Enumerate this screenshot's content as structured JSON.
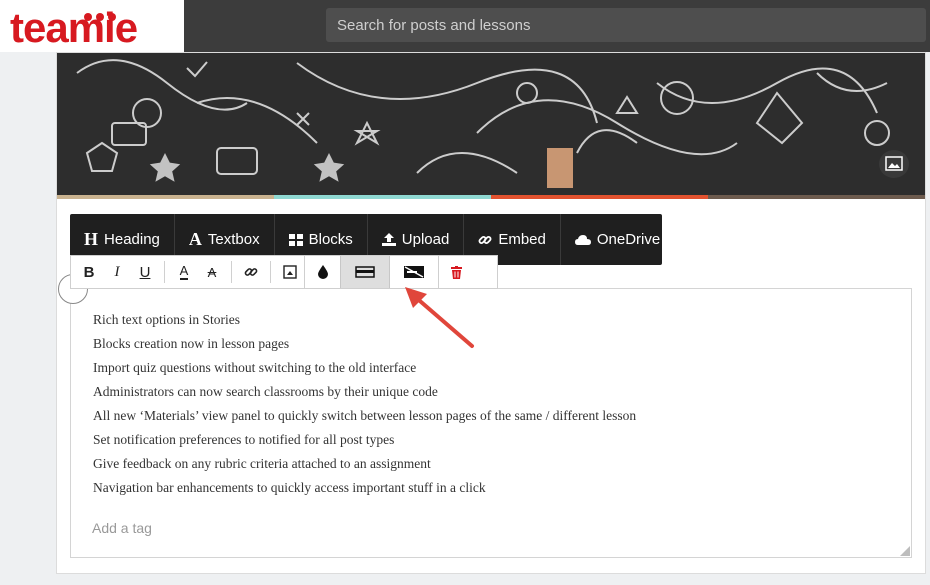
{
  "brand": {
    "logo_text": "teamie"
  },
  "search": {
    "placeholder": "Search for posts and lessons"
  },
  "toolbar": {
    "items": [
      {
        "label": "Heading",
        "icon": "heading-icon",
        "glyph": "H"
      },
      {
        "label": "Textbox",
        "icon": "textbox-icon",
        "glyph": "A"
      },
      {
        "label": "Blocks",
        "icon": "blocks-icon",
        "glyph": ""
      },
      {
        "label": "Upload",
        "icon": "upload-icon",
        "glyph": ""
      },
      {
        "label": "Embed",
        "icon": "link-icon",
        "glyph": ""
      },
      {
        "label": "OneDrive",
        "icon": "cloud-icon",
        "glyph": ""
      }
    ]
  },
  "format_toolbar": {
    "bold": "B",
    "italic": "I",
    "underline": "U",
    "font_color": "A",
    "clear_format": "A",
    "icons": [
      "bold-icon",
      "italic-icon",
      "underline-icon",
      "font-color-icon",
      "clear-format-icon",
      "link-icon",
      "image-icon",
      "color-drop-icon",
      "block-width-icon",
      "no-background-icon",
      "delete-icon"
    ]
  },
  "content": {
    "lines": [
      "Rich text options in Stories",
      "Blocks creation now in lesson pages",
      "Import quiz questions without switching to the old interface",
      "Administrators can now search classrooms by their unique code",
      "All new ‘Materials’ view panel to quickly switch between lesson pages of the same / different lesson",
      "Set notification preferences to notified for all post types",
      "Give feedback on any rubric criteria attached to an assignment",
      "Navigation bar enhancements to quickly access important stuff in a click"
    ],
    "tag_placeholder": "Add a tag"
  },
  "colors": {
    "brand_red": "#d71920",
    "stripe_1": "#c9b28f",
    "stripe_2": "#8fd8d2",
    "stripe_3": "#e2522f",
    "stripe_4": "#6d5b4e",
    "arrow": "#e0463b"
  }
}
